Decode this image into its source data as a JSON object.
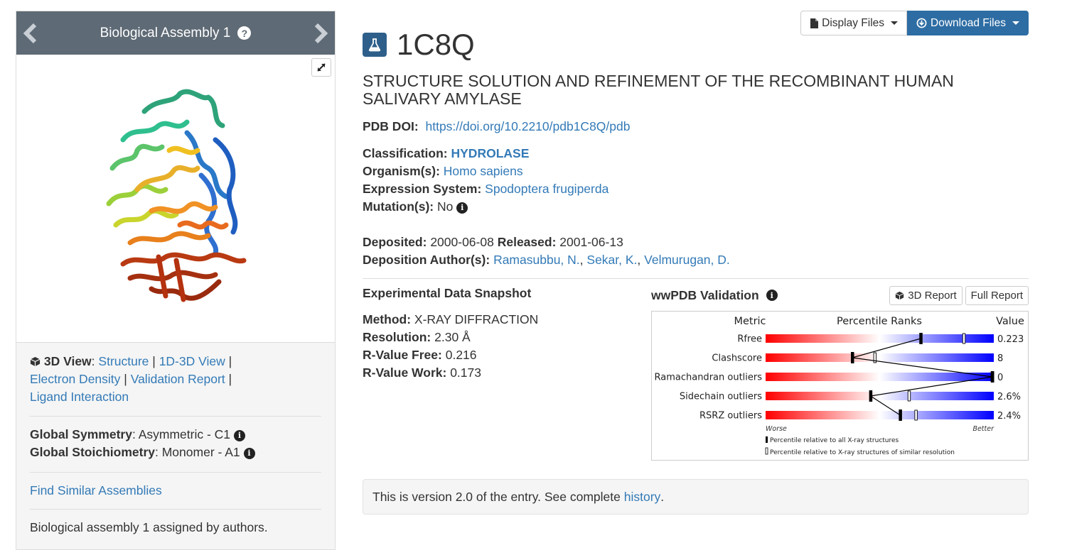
{
  "assembly": {
    "title": "Biological Assembly 1",
    "help_icon": "question-circle-icon",
    "view_label": "3D View",
    "view_links": [
      "Structure",
      "1D-3D View",
      "Electron Density",
      "Validation Report",
      "Ligand Interaction"
    ],
    "symmetry_label": "Global Symmetry",
    "symmetry_value": "Asymmetric - C1",
    "stoichiometry_label": "Global Stoichiometry",
    "stoichiometry_value": "Monomer - A1",
    "find_similar": "Find Similar Assemblies",
    "assigned_note": "Biological assembly 1 assigned by authors."
  },
  "buttons": {
    "display_files": "Display Files",
    "download_files": "Download Files"
  },
  "entry": {
    "pdb_id": "1C8Q",
    "title": "STRUCTURE SOLUTION AND REFINEMENT OF THE RECOMBINANT HUMAN SALIVARY AMYLASE",
    "doi_label": "PDB DOI:",
    "doi": "https://doi.org/10.2210/pdb1C8Q/pdb",
    "classification_label": "Classification:",
    "classification": "HYDROLASE",
    "organism_label": "Organism(s):",
    "organism": "Homo sapiens",
    "expression_label": "Expression System:",
    "expression": "Spodoptera frugiperda",
    "mutation_label": "Mutation(s):",
    "mutation": "No",
    "deposited_label": "Deposited:",
    "deposited": "2000-06-08",
    "released_label": "Released:",
    "released": "2001-06-13",
    "authors_label": "Deposition Author(s):",
    "authors": [
      "Ramasubbu, N.",
      "Sekar, K.",
      "Velmurugan, D."
    ]
  },
  "snapshot": {
    "heading": "Experimental Data Snapshot",
    "method_label": "Method:",
    "method": "X-RAY DIFFRACTION",
    "resolution_label": "Resolution:",
    "resolution": "2.30 Å",
    "rfree_label": "R-Value Free:",
    "rfree": "0.216",
    "rwork_label": "R-Value Work:",
    "rwork": "0.173"
  },
  "validation": {
    "heading": "wwPDB Validation",
    "report_3d": "3D Report",
    "full_report": "Full Report"
  },
  "chart_data": {
    "type": "bar",
    "title": "",
    "headers": {
      "metric": "Metric",
      "ranks": "Percentile Ranks",
      "value": "Value"
    },
    "metrics": [
      "Rfree",
      "Clashscore",
      "Ramachandran outliers",
      "Sidechain outliers",
      "RSRZ outliers"
    ],
    "values": [
      "0.223",
      "8",
      "0",
      "2.6%",
      "2.4%"
    ],
    "percentile_all": [
      68,
      38,
      100,
      46,
      59
    ],
    "percentile_similar": [
      87,
      48,
      100,
      63,
      66
    ],
    "axis_low": "Worse",
    "axis_high": "Better",
    "legend_all": "Percentile relative to all X-ray structures",
    "legend_similar": "Percentile relative to X-ray structures of similar resolution",
    "colors": {
      "worse": "#ff0000",
      "mid": "#ffffff",
      "better": "#0000ff"
    }
  },
  "version": {
    "text_before": "This is version 2.0 of the entry. See complete ",
    "link": "history",
    "text_after": "."
  }
}
